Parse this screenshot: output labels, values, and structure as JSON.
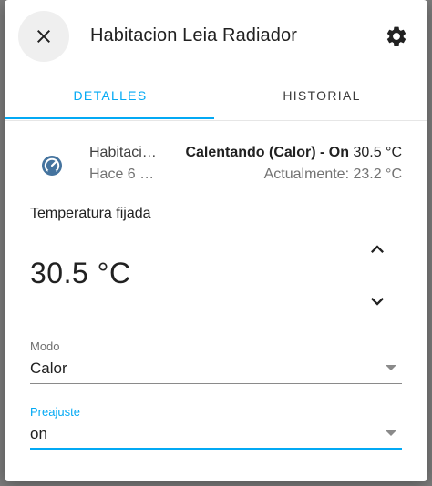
{
  "dialog": {
    "title": "Habitacion Leia Radiador"
  },
  "tabs": [
    {
      "label": "DETALLES"
    },
    {
      "label": "HISTORIAL"
    }
  ],
  "entity": {
    "name": "Habitaci…",
    "last_changed": "Hace 6 …",
    "state_main": "Calentando (Calor) - On",
    "state_target": " 30.5 °C",
    "current": "Actualmente: 23.2 °C",
    "icon": "thermostat-icon"
  },
  "setpoint": {
    "label": "Temperatura fijada",
    "value": "30.5 °C"
  },
  "mode": {
    "label": "Modo",
    "value": "Calor"
  },
  "preset": {
    "label": "Preajuste",
    "value": "on"
  },
  "colors": {
    "accent": "#03a9f4",
    "icon": "#44739e"
  }
}
